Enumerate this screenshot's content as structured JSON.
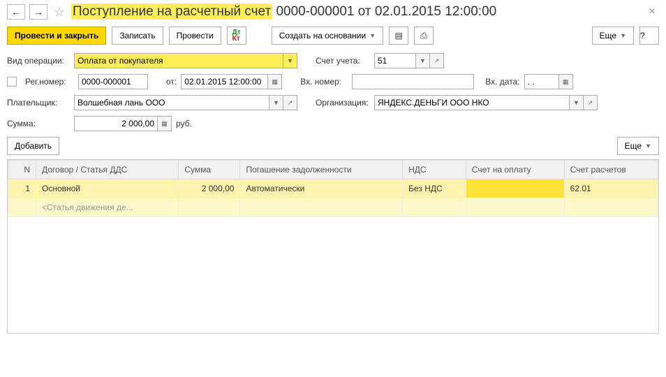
{
  "title": {
    "highlight": "Поступление на расчетный счет",
    "rest": " 0000-000001 от 02.01.2015 12:00:00"
  },
  "toolbar": {
    "post_close": "Провести и закрыть",
    "save": "Записать",
    "post": "Провести",
    "create_based": "Создать на основании",
    "more": "Еще",
    "help": "?"
  },
  "fields": {
    "operation_lbl": "Вид операции:",
    "operation_val": "Оплата от покупателя",
    "account_lbl": "Счет учета:",
    "account_val": "51",
    "regnum_lbl": "Рег.номер:",
    "regnum_val": "0000-000001",
    "from_lbl": "от:",
    "from_val": "02.01.2015 12:00:00",
    "in_num_lbl": "Вх. номер:",
    "in_num_val": "",
    "in_date_lbl": "Вх. дата:",
    "in_date_val": ". .",
    "payer_lbl": "Плательщик:",
    "payer_val": "Волшебная лань ООО",
    "org_lbl": "Организация:",
    "org_val": "ЯНДЕКС.ДЕНЬГИ ООО НКО",
    "sum_lbl": "Сумма:",
    "sum_val": "2 000,00",
    "sum_cur": "руб."
  },
  "grid_actions": {
    "add": "Добавить",
    "more": "Еще"
  },
  "grid": {
    "headers": {
      "n": "N",
      "contract": "Договор / Статья ДДС",
      "sum": "Сумма",
      "repay": "Погашение задолженности",
      "vat": "НДС",
      "invoice": "Счет на оплату",
      "settle": "Счет расчетов"
    },
    "rows": [
      {
        "n": "1",
        "contract": "Основной",
        "sum": "2 000,00",
        "repay": "Автоматически",
        "vat": "Без НДС",
        "invoice": "",
        "settle": "62.01"
      }
    ],
    "subrow_contract": "<Статья движения де..."
  }
}
